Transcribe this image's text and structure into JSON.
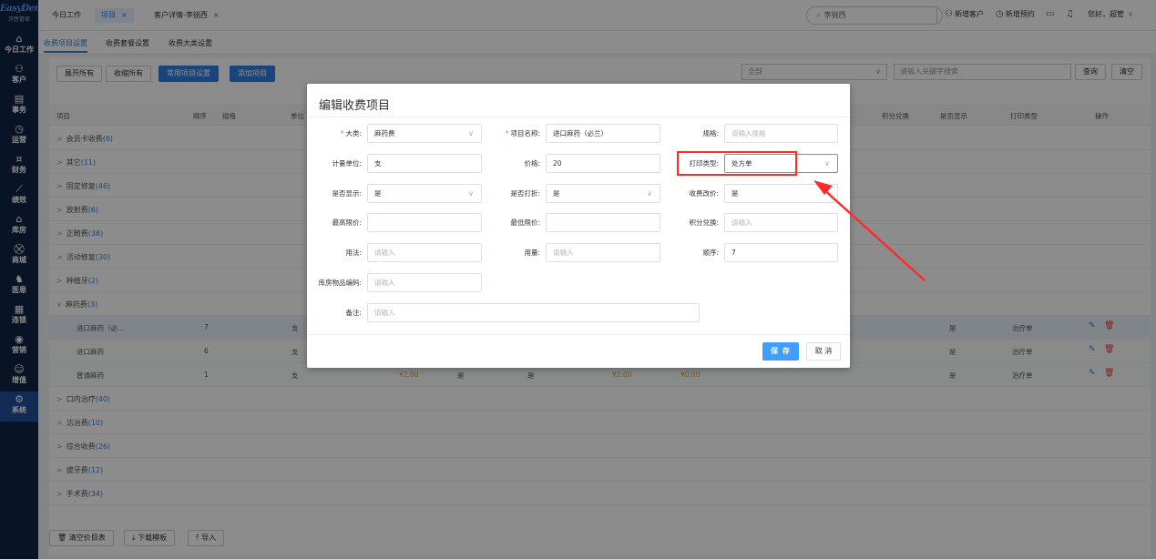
{
  "sidebar": {
    "logo": "EasyDent",
    "logo_sub": "牙医管家",
    "items": [
      {
        "icon": "⌂",
        "label": "今日工作"
      },
      {
        "icon": "⚇",
        "label": "客户"
      },
      {
        "icon": "▤",
        "label": "事务"
      },
      {
        "icon": "◷",
        "label": "运营"
      },
      {
        "icon": "¤",
        "label": "财务"
      },
      {
        "icon": "⟋",
        "label": "绩效"
      },
      {
        "icon": "⌂",
        "label": "库房"
      },
      {
        "icon": "⛒",
        "label": "商城"
      },
      {
        "icon": "♞",
        "label": "医患"
      },
      {
        "icon": "▦",
        "label": "连锁"
      },
      {
        "icon": "◉",
        "label": "营销"
      },
      {
        "icon": "☺",
        "label": "增值"
      },
      {
        "icon": "⚙",
        "label": "系统"
      }
    ]
  },
  "topbar": {
    "tabs": [
      {
        "label": "今日工作",
        "close": ""
      },
      {
        "label": "项目",
        "close": "×"
      },
      {
        "label": "客户详情-李锐西",
        "close": "×"
      }
    ],
    "search_value": "李锐西",
    "actions": {
      "new_customer": "新增客户",
      "new_booking": "新增预约",
      "greeting": "您好，超管"
    }
  },
  "subtabs": [
    "收费项目设置",
    "收费套餐设置",
    "收费大类设置"
  ],
  "toolbar": {
    "expand_all": "展开所有",
    "collapse_all": "收缩所有",
    "common_settings": "常用项目设置",
    "add_item": "添加项目",
    "filter_select": "全部",
    "keyword_placeholder": "请输入关键字搜索",
    "query": "查询",
    "clear": "清空"
  },
  "table": {
    "headers": {
      "item": "项目",
      "order": "顺序",
      "spec": "规格",
      "unit": "单位",
      "points": "积分兑换",
      "show": "是否显示",
      "print": "打印类型",
      "ops": "操作"
    },
    "categories": [
      {
        "arrow": ">",
        "name": "会员卡收费",
        "count": "(6)"
      },
      {
        "arrow": ">",
        "name": "其它",
        "count": "(11)"
      },
      {
        "arrow": ">",
        "name": "固定修复",
        "count": "(46)"
      },
      {
        "arrow": ">",
        "name": "放射费",
        "count": "(6)"
      },
      {
        "arrow": ">",
        "name": "正畸费",
        "count": "(38)"
      },
      {
        "arrow": ">",
        "name": "活动修复",
        "count": "(30)"
      },
      {
        "arrow": ">",
        "name": "种植牙",
        "count": "(2)"
      },
      {
        "arrow": "∨",
        "name": "麻药费",
        "count": "(3)"
      }
    ],
    "sub_rows": [
      {
        "name": "进口麻药（必...",
        "order": "7",
        "unit": "支",
        "price": "",
        "show1": "",
        "show2": "",
        "price2": "",
        "price3": "",
        "show": "是",
        "print": "治疗单"
      },
      {
        "name": "进口麻药",
        "order": "6",
        "unit": "支",
        "price": "",
        "show1": "",
        "show2": "",
        "price2": "",
        "price3": "",
        "show": "是",
        "print": "治疗单"
      },
      {
        "name": "普通麻药",
        "order": "1",
        "unit": "支",
        "price": "¥2.00",
        "show1": "是",
        "show2": "是",
        "price2": "¥2.00",
        "price3": "¥0.00",
        "show": "是",
        "print": "治疗单"
      }
    ],
    "categories_after": [
      {
        "arrow": ">",
        "name": "口内治疗",
        "count": "(40)"
      },
      {
        "arrow": ">",
        "name": "洁治费",
        "count": "(10)"
      },
      {
        "arrow": ">",
        "name": "综合收费",
        "count": "(26)"
      },
      {
        "arrow": ">",
        "name": "拔牙费",
        "count": "(12)"
      },
      {
        "arrow": ">",
        "name": "手术费",
        "count": "(34)"
      }
    ]
  },
  "bottom": {
    "clear_price": "清空价目表",
    "download_template": "下载模板",
    "import": "导入"
  },
  "dialog": {
    "title": "编辑收费项目",
    "fields": {
      "category_label": "大类:",
      "category_value": "麻药费",
      "item_name_label": "项目名称:",
      "item_name_value": "进口麻药（必兰）",
      "spec_label": "规格:",
      "spec_placeholder": "请输入规格",
      "unit_label": "计量单位:",
      "unit_value": "支",
      "price_label": "价格:",
      "price_value": "20",
      "print_type_label": "打印类型:",
      "print_type_value": "处方单",
      "show_label": "是否显示:",
      "show_value": "是",
      "discount_label": "是否打折:",
      "discount_value": "是",
      "change_price_label": "收费改价:",
      "change_price_value": "是",
      "max_price_label": "最高限价:",
      "min_price_label": "最低限价:",
      "points_label": "积分兑换:",
      "points_placeholder": "请输入",
      "usage_label": "用法:",
      "usage_placeholder": "请输入",
      "dosage_label": "用量:",
      "dosage_placeholder": "请输入",
      "order_label": "顺序:",
      "order_value": "7",
      "stock_code_label": "库房物品编码:",
      "stock_code_placeholder": "请输入",
      "remark_label": "备注:",
      "remark_placeholder": "请输入"
    },
    "save": "保 存",
    "cancel": "取 消"
  },
  "colors": {
    "accent": "#2d7fe0",
    "sidebar": "#0f2546",
    "highlight": "#ff2a2a"
  }
}
